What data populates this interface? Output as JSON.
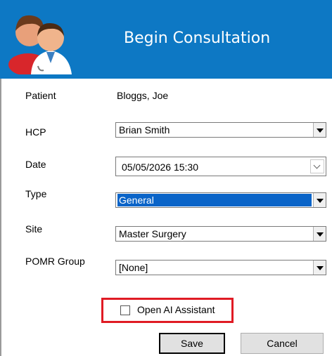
{
  "dialog": {
    "title": "Begin Consultation"
  },
  "fields": {
    "patient": {
      "label": "Patient",
      "value": "Bloggs, Joe"
    },
    "hcp": {
      "label": "HCP",
      "value": "Brian Smith"
    },
    "date": {
      "label": "Date",
      "value": "05/05/2026 15:30"
    },
    "type": {
      "label": "Type",
      "value": "General"
    },
    "site": {
      "label": "Site",
      "value": "Master Surgery"
    },
    "pomr": {
      "label": "POMR Group",
      "value": "[None]"
    }
  },
  "ai_assistant": {
    "label": "Open AI Assistant",
    "checked": false
  },
  "buttons": {
    "save": "Save",
    "cancel": "Cancel"
  },
  "icons": {
    "header": "patient-doctor-icon",
    "dropdown": "chevron-down-icon",
    "calendar": "calendar-icon"
  },
  "colors": {
    "header_bg": "#0d78c4",
    "selection": "#0a64c8",
    "highlight_border": "#e01b24"
  }
}
